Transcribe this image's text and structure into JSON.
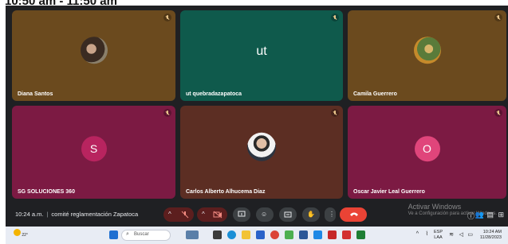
{
  "top_caption": "10:50 am - 11:50 am",
  "tiles": [
    {
      "name": "Diana Santos",
      "bg": "#6b4a1e",
      "avatar": "photo-1"
    },
    {
      "name": "ut quebradazapatoca",
      "bg": "#0f5a4c",
      "avatar_text": "ut"
    },
    {
      "name": "Camila Guerrero",
      "bg": "#6b4a1e",
      "avatar": "photo-2"
    },
    {
      "name": "SG SOLUCIONES 360",
      "bg": "#7c1a43",
      "avatar_text": "S"
    },
    {
      "name": "Carlos Alberto Alhucema Diaz",
      "bg": "#5c2e23",
      "avatar": "photo-3"
    },
    {
      "name": "Oscar Javier Leal Guerrero",
      "bg": "#7c1a43",
      "avatar_text": "O"
    }
  ],
  "bottom_bar": {
    "time": "10:24 a.m.",
    "separator": "|",
    "meeting_title": "comité reglamentación Zapatoca"
  },
  "controls": [
    "chevron-up-icon",
    "mic-off-icon",
    "chevron-up-icon",
    "camera-off-icon",
    "present-icon",
    "emoji-icon",
    "captions-icon",
    "raise-hand-icon",
    "more-icon",
    "end-call-icon"
  ],
  "watermark": {
    "title": "Activar Windows",
    "subtitle": "Ve a Configuración para activar Windows."
  },
  "taskbar": {
    "weather_temp": "22°",
    "search_placeholder": "Buscar",
    "lang_line1": "ESP",
    "lang_line2": "LAA",
    "clock_time": "10:24 AM",
    "clock_date": "11/28/2023"
  },
  "colors": {
    "accent_red": "#ea4335",
    "tile_brown": "#6b4a1e",
    "tile_teal": "#0f5a4c",
    "tile_magenta": "#7c1a43",
    "dark_bg": "#1f2023"
  }
}
